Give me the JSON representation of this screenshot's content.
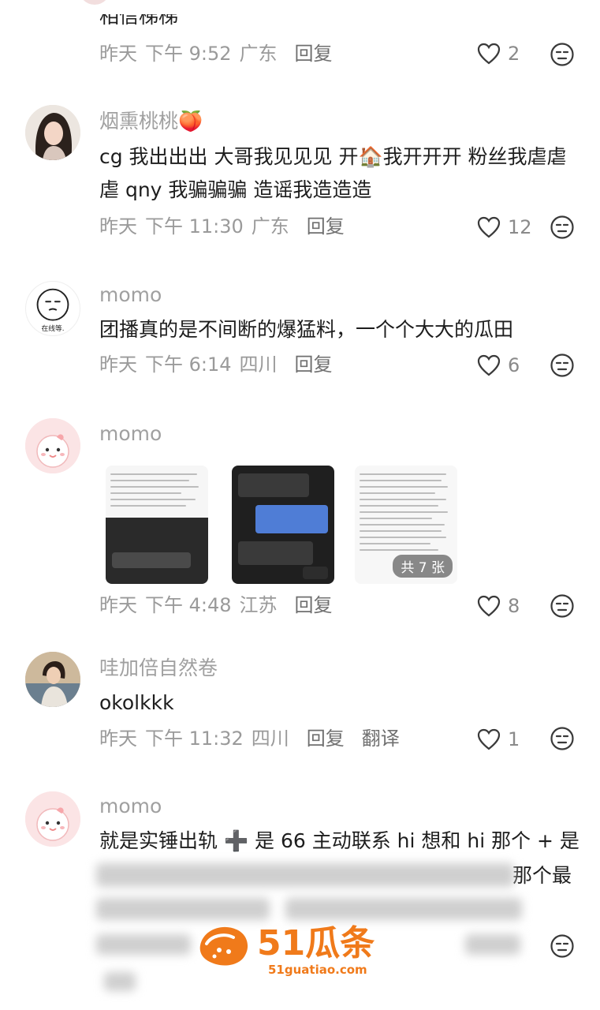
{
  "comments": [
    {
      "text": "相信梯梯",
      "time": "昨天",
      "clock": "下午 9:52",
      "region": "广东",
      "reply": "回复",
      "likes": "2"
    },
    {
      "username": "烟熏桃桃🍑",
      "text": "cg 我出出出 大哥我见见见 开🏠我开开开 粉丝我虐虐虐 qny 我骗骗骗 造谣我造造造",
      "time": "昨天",
      "clock": "下午 11:30",
      "region": "广东",
      "reply": "回复",
      "likes": "12"
    },
    {
      "username": "momo",
      "text": "团播真的是不间断的爆猛料，一个个大大的瓜田",
      "avatar_caption": "在线等.",
      "time": "昨天",
      "clock": "下午 6:14",
      "region": "四川",
      "reply": "回复",
      "likes": "6"
    },
    {
      "username": "momo",
      "image_count_label": "共 7 张",
      "time": "昨天",
      "clock": "下午 4:48",
      "region": "江苏",
      "reply": "回复",
      "likes": "8"
    },
    {
      "username": "哇加倍自然卷",
      "text": "okolkkk",
      "time": "昨天",
      "clock": "下午 11:32",
      "region": "四川",
      "reply": "回复",
      "translate": "翻译",
      "likes": "1"
    },
    {
      "username": "momo",
      "text_line1": "就是实锤出轨 ➕ 是 66 主动联系 hi 想和 hi 那个 + 是",
      "text_line2_tail": "那个最"
    }
  ],
  "watermark": {
    "brand": "51瓜条",
    "url": "51guatiao.com"
  },
  "colors": {
    "accent_orange": "#f07a1a",
    "meta_gray": "#9a9a9a"
  }
}
